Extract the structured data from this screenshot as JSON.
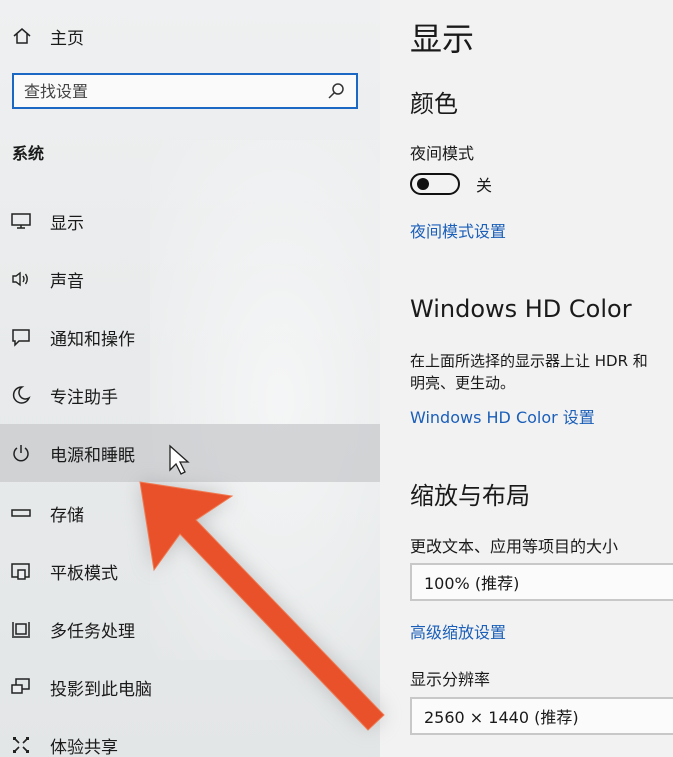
{
  "sidebar": {
    "home_label": "主页",
    "search_placeholder": "查找设置",
    "group_title": "系统",
    "items": [
      {
        "label": "显示",
        "icon": "monitor-icon"
      },
      {
        "label": "声音",
        "icon": "speaker-icon"
      },
      {
        "label": "通知和操作",
        "icon": "notification-icon"
      },
      {
        "label": "专注助手",
        "icon": "moon-icon"
      },
      {
        "label": "电源和睡眠",
        "icon": "power-icon"
      },
      {
        "label": "存储",
        "icon": "storage-icon"
      },
      {
        "label": "平板模式",
        "icon": "tablet-mode-icon"
      },
      {
        "label": "多任务处理",
        "icon": "multitasking-icon"
      },
      {
        "label": "投影到此电脑",
        "icon": "projecting-icon"
      },
      {
        "label": "体验共享",
        "icon": "shared-experiences-icon"
      }
    ]
  },
  "main": {
    "title": "显示",
    "color_section": "颜色",
    "night_light_label": "夜间模式",
    "night_light_state": "关",
    "night_light_link": "夜间模式设置",
    "hdr_section": "Windows HD Color",
    "hdr_desc_line1": "在上面所选择的显示器上让 HDR 和",
    "hdr_desc_line2": "明亮、更生动。",
    "hdr_link": "Windows HD Color 设置",
    "scale_section": "缩放与布局",
    "scale_label": "更改文本、应用等项目的大小",
    "scale_value": "100% (推荐)",
    "scale_link": "高级缩放设置",
    "resolution_label": "显示分辨率",
    "resolution_value": "2560 × 1440 (推荐)"
  },
  "colors": {
    "accent": "#1b67c4",
    "link": "#1b5fb9",
    "arrow": "#e8512a"
  }
}
